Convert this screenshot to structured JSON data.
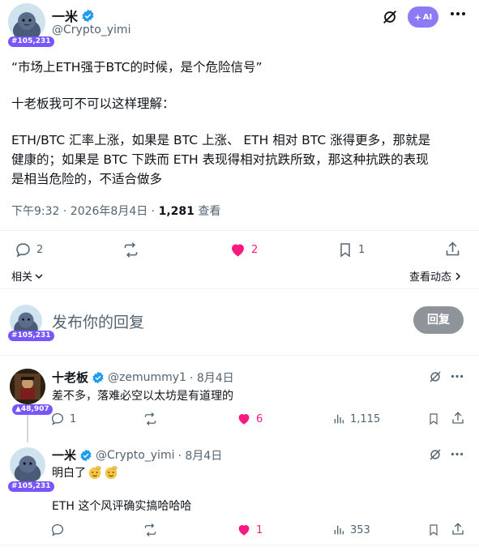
{
  "main_post": {
    "author_name": "一米",
    "handle": "@Crypto_yimi",
    "badge": "#105,231",
    "lines": [
      "“市场上ETH强于BTC的时候，是个危险信号”",
      "十老板我可不可以这样理解：",
      "ETH/BTC 汇率上涨，如果是 BTC 上涨、 ETH 相对 BTC 涨得更多，那就是",
      "健康的；如果是 BTC 下跌而 ETH 表现得相对抗跌所致，那这种抗跌的表现",
      "是相当危险的，不适合做多"
    ],
    "timestamp": "下午9:32 · 2026年8月4日 · ",
    "views_count": "1,281",
    "views_label": " 查看",
    "actions": {
      "reply": "2",
      "retweet": "",
      "like": "2",
      "bookmark": "1"
    },
    "related_label": "相关",
    "view_activity_label": "查看动态",
    "ai_label": "AI"
  },
  "composer": {
    "badge": "#105,231",
    "placeholder": "发布你的回复",
    "button_label": "回复"
  },
  "replies": [
    {
      "author_name": "十老板",
      "handle": "@zemummy1",
      "date": "· 8月4日",
      "badge": "48,907",
      "text": "差不多，落难必空以太坊是有道理的",
      "actions": {
        "reply": "1",
        "retweet": "",
        "like": "6",
        "views": "1,115"
      }
    },
    {
      "author_name": "一米",
      "handle": "@Crypto_yimi",
      "date": "· 8月4日",
      "badge": "#105,231",
      "text_line1": "明白了",
      "text_line2": "ETH 这个风评确实搞哈哈哈",
      "actions": {
        "reply": "",
        "retweet": "",
        "like": "1",
        "views": "353"
      }
    }
  ],
  "colors": {
    "verified": "#1d9bf0",
    "like": "#f91880",
    "badge": "#7856ff",
    "text_secondary": "#536471"
  }
}
